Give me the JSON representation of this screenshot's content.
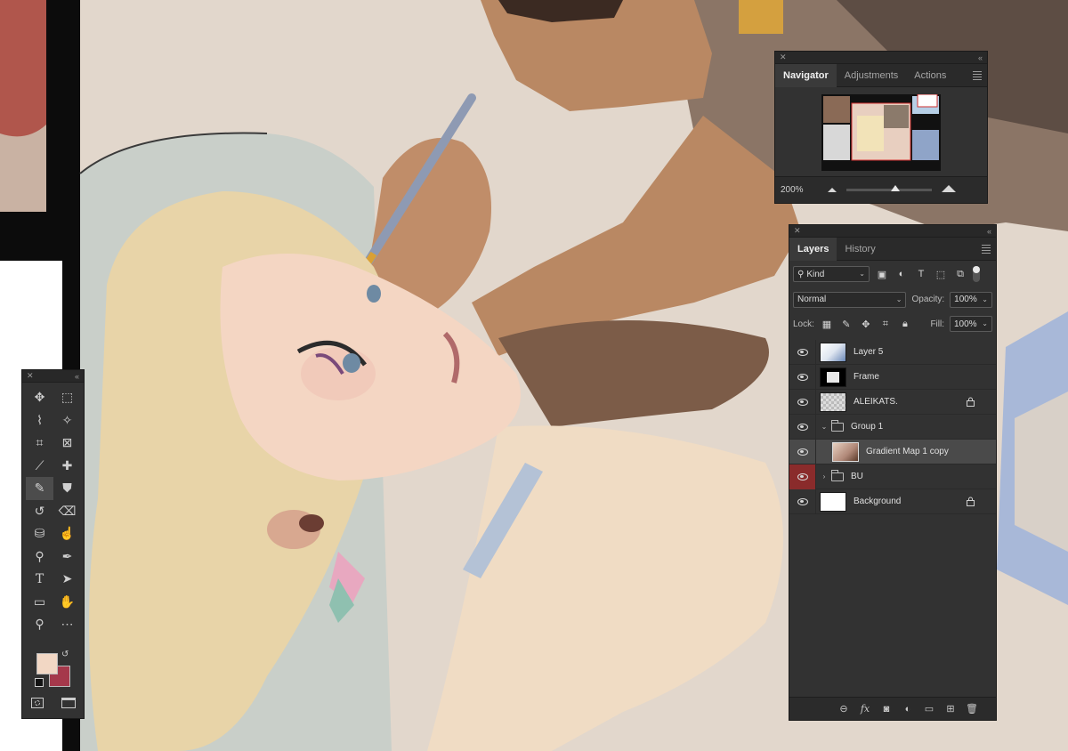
{
  "navigator": {
    "tabs": [
      "Navigator",
      "Adjustments",
      "Actions"
    ],
    "zoom": "200%"
  },
  "layers_panel": {
    "tabs": [
      "Layers",
      "History"
    ],
    "filter": "Kind",
    "blend_mode": "Normal",
    "opacity_label": "Opacity:",
    "opacity_value": "100%",
    "lock_label": "Lock:",
    "fill_label": "Fill:",
    "fill_value": "100%",
    "layers": [
      {
        "name": "Layer 5",
        "type": "layer",
        "locked": false
      },
      {
        "name": "Frame",
        "type": "layer",
        "locked": false
      },
      {
        "name": "ALEIKATS.",
        "type": "layer",
        "locked": true
      },
      {
        "name": "Group 1",
        "type": "group",
        "expanded": true
      },
      {
        "name": "Gradient Map 1 copy",
        "type": "layer",
        "selected": true
      },
      {
        "name": "BU",
        "type": "group",
        "expanded": false
      },
      {
        "name": "Background",
        "type": "layer",
        "locked": true
      }
    ]
  },
  "toolbar": {
    "foreground_color": "#f2d7c4",
    "background_color": "#a5384b",
    "active_tool": "brush-tool"
  },
  "colors": {
    "panel_bg": "#323232",
    "canvas_bg": "#e2d7cc"
  }
}
